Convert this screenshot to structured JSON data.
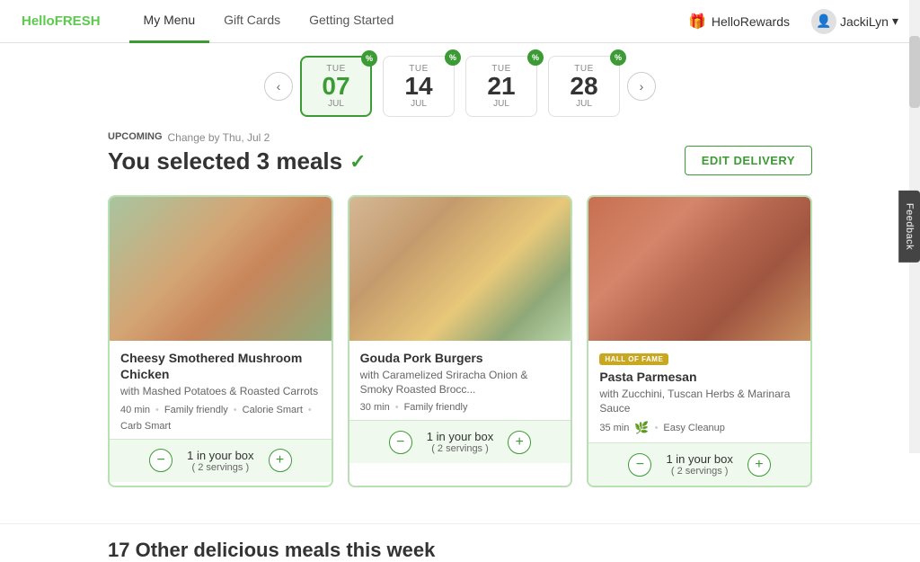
{
  "header": {
    "logo_hello": "Hello",
    "logo_fresh": "FRESH",
    "nav": [
      {
        "id": "my-menu",
        "label": "My Menu",
        "active": true
      },
      {
        "id": "gift-cards",
        "label": "Gift Cards",
        "active": false
      },
      {
        "id": "getting-started",
        "label": "Getting Started",
        "active": false
      }
    ],
    "hello_rewards_label": "HelloRewards",
    "user_name": "JackiLyn",
    "chevron": "▾"
  },
  "date_selector": {
    "prev_arrow": "‹",
    "next_arrow": "›",
    "dates": [
      {
        "day": "TUE",
        "num": "07",
        "month": "JUL",
        "active": true,
        "badge": "%"
      },
      {
        "day": "TUE",
        "num": "14",
        "month": "JUL",
        "active": false,
        "badge": "%"
      },
      {
        "day": "TUE",
        "num": "21",
        "month": "JUL",
        "active": false,
        "badge": "%"
      },
      {
        "day": "TUE",
        "num": "28",
        "month": "JUL",
        "active": false,
        "badge": "%"
      }
    ]
  },
  "selected_section": {
    "upcoming_label": "UPCOMING",
    "change_by": "Change by Thu, Jul 2",
    "title": "You selected 3 meals",
    "check": "✓",
    "edit_delivery_btn": "EDIT DELIVERY"
  },
  "meals": [
    {
      "id": "chicken",
      "img_class": "img-chicken",
      "badge": null,
      "title": "Cheesy Smothered Mushroom Chicken",
      "subtitle": "with Mashed Potatoes & Roasted Carrots",
      "time": "40 min",
      "tags": [
        "Family friendly",
        "Calorie Smart",
        "Carb Smart"
      ],
      "in_box": "1 in your box",
      "servings": "( 2 servings )"
    },
    {
      "id": "burger",
      "img_class": "img-burger",
      "badge": null,
      "title": "Gouda Pork Burgers",
      "subtitle": "with Caramelized Sriracha Onion & Smoky Roasted Brocc...",
      "time": "30 min",
      "tags": [
        "Family friendly"
      ],
      "in_box": "1 in your box",
      "servings": "( 2 servings )"
    },
    {
      "id": "pasta",
      "img_class": "img-pasta",
      "badge": "HALL OF FAME",
      "title": "Pasta Parmesan",
      "subtitle": "with Zucchini, Tuscan Herbs & Marinara Sauce",
      "time": "35 min",
      "tags": [
        "Easy Cleanup"
      ],
      "in_box": "1 in your box",
      "servings": "( 2 servings )",
      "leaf": true
    }
  ],
  "other_meals_section": {
    "title": "17 Other delicious meals this week"
  },
  "feedback": {
    "label": "Feedback"
  },
  "icons": {
    "gift": "🎁",
    "user": "👤",
    "minus": "−",
    "plus": "+"
  }
}
